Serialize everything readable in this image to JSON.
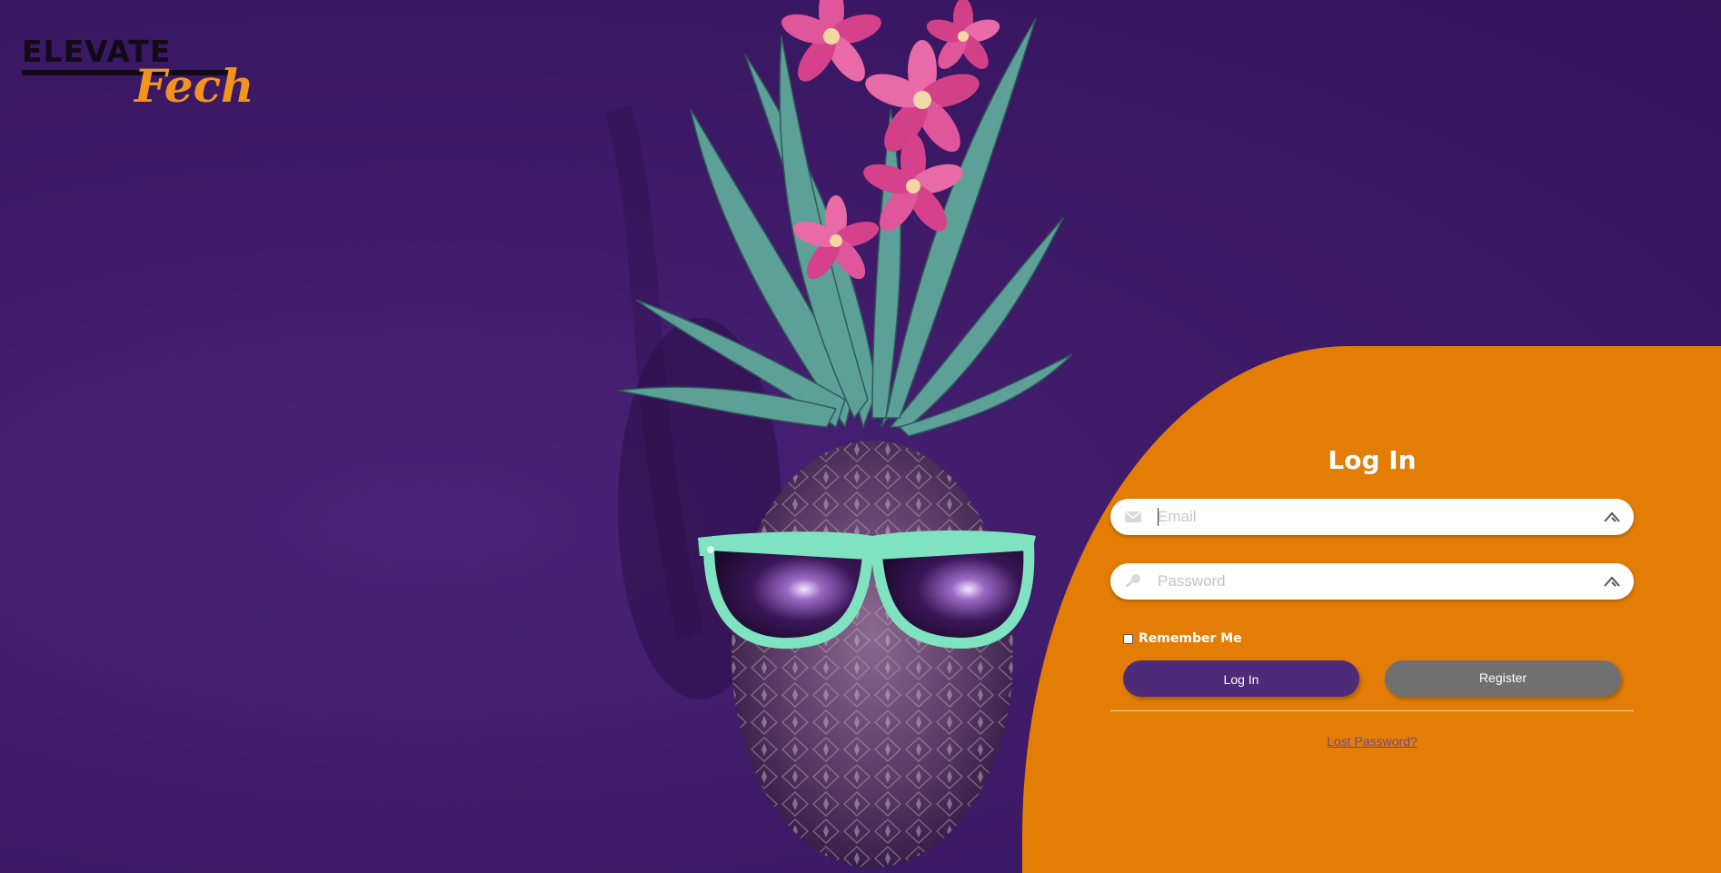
{
  "logo": {
    "main_text": "ELEVATE",
    "script_text": "Fech"
  },
  "hero": {
    "description": "pineapple-with-flowers-and-sunglasses"
  },
  "login": {
    "title": "Log In",
    "email": {
      "placeholder": "Email",
      "value": "",
      "icon": "envelope-icon",
      "trail_icon": "autofill-key-icon"
    },
    "password": {
      "placeholder": "Password",
      "value": "",
      "icon": "key-icon",
      "trail_icon": "autofill-key-icon"
    },
    "remember_label": "Remember Me",
    "remember_checked": false,
    "login_button": "Log In",
    "register_button": "Register",
    "lost_password_link": "Lost Password?"
  },
  "colors": {
    "background_purple": "#3e1a68",
    "panel_orange": "#e37d06",
    "login_button": "#4e2b79",
    "register_button": "#707070",
    "logo_orange": "#f0941f"
  }
}
